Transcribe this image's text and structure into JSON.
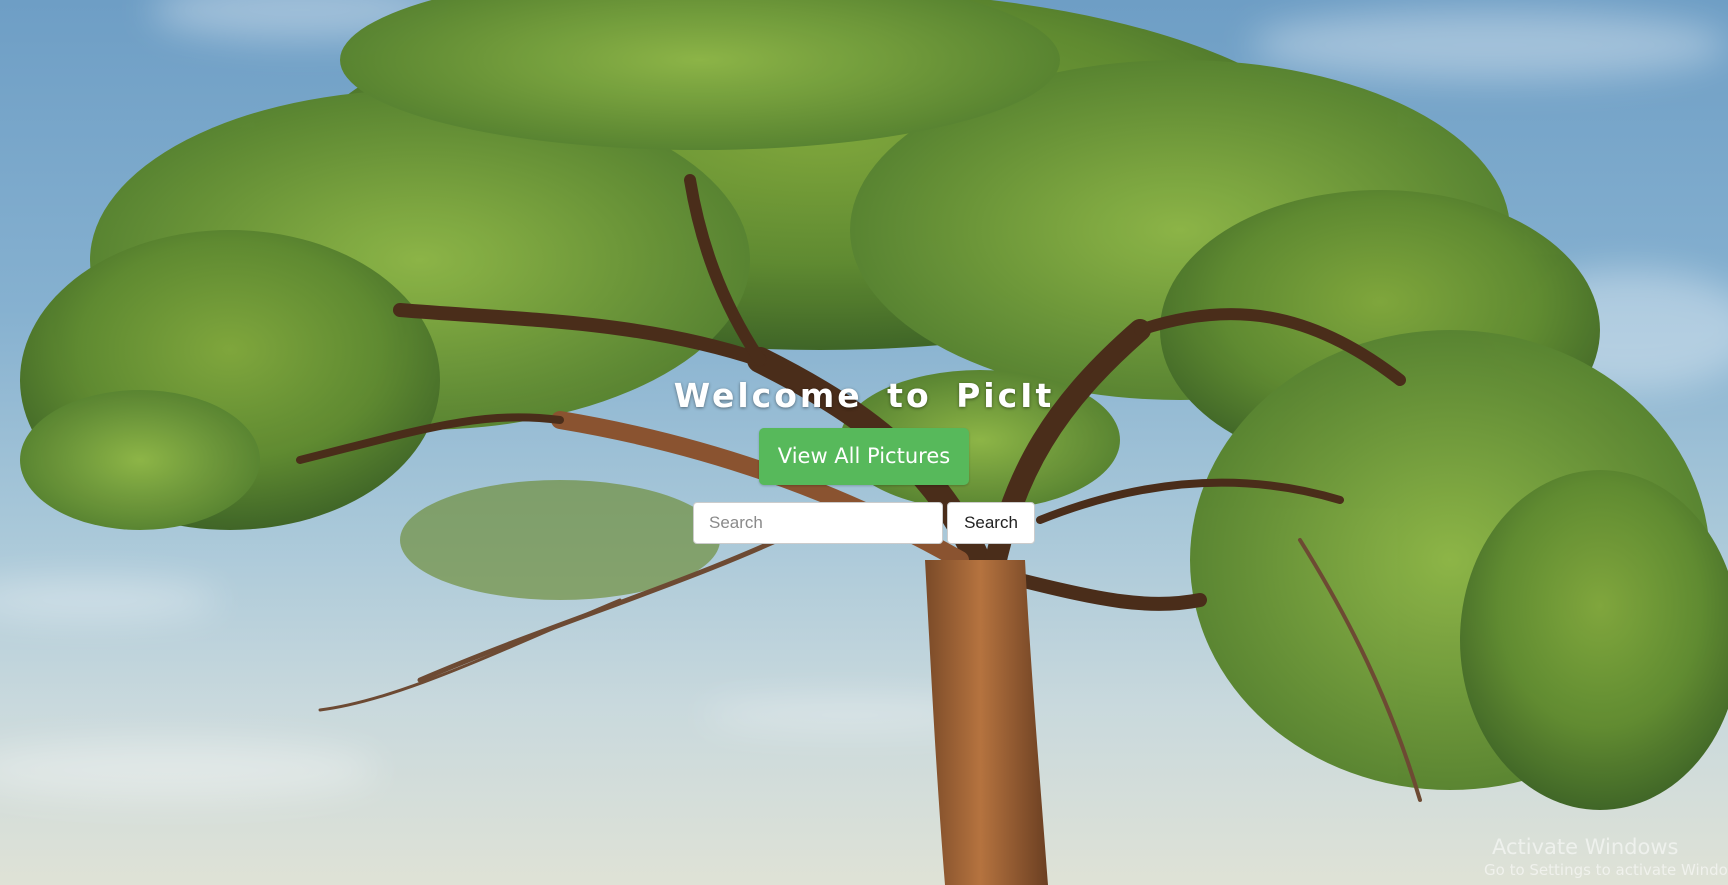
{
  "hero": {
    "title": "Welcome to PicIt",
    "view_all_label": "View All Pictures"
  },
  "search": {
    "placeholder": "Search",
    "value": "",
    "button_label": "Search"
  },
  "watermark": {
    "title": "Activate Windows",
    "subtitle": "Go to Settings to activate Windows."
  },
  "background": {
    "subject": "tree-photo",
    "sky_color": "#86b1d0",
    "foliage_color": "#5f8a2e"
  },
  "colors": {
    "accent": "#57b95b",
    "title_text": "#ffffff"
  }
}
